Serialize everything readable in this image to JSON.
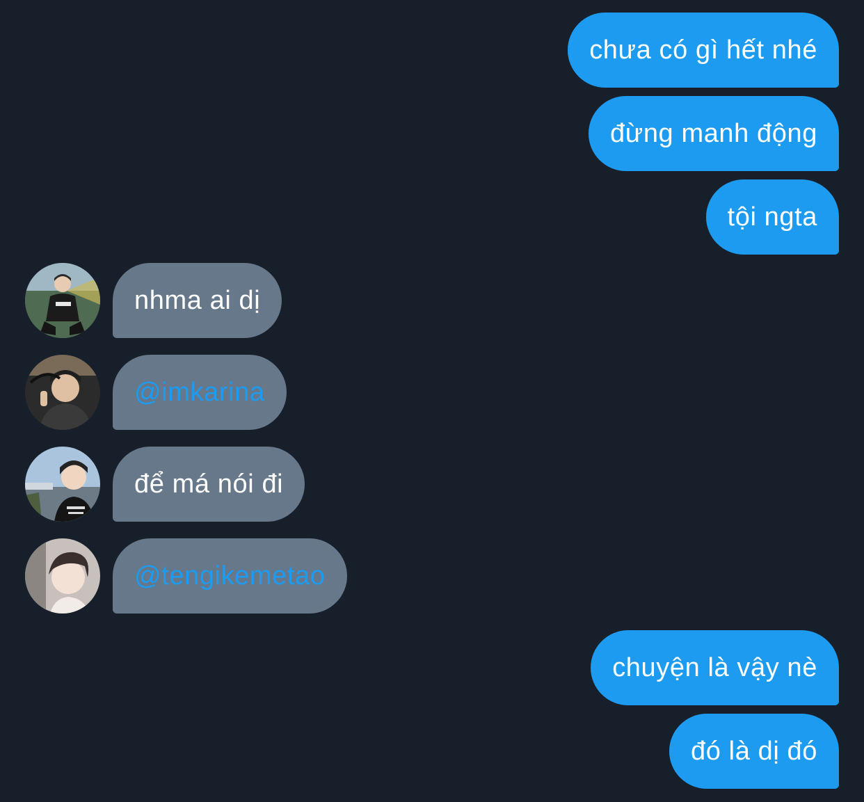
{
  "thread": {
    "messages": [
      {
        "direction": "outgoing",
        "text": "chưa có gì hết nhé"
      },
      {
        "direction": "outgoing",
        "text": "đừng manh động"
      },
      {
        "direction": "outgoing",
        "text": "tội ngta"
      },
      {
        "direction": "incoming",
        "text": "nhma ai dị",
        "avatar": "user-avatar-photo"
      },
      {
        "direction": "incoming",
        "text": "@imkarina",
        "avatar": "user-avatar-photo",
        "is_mention": true
      },
      {
        "direction": "incoming",
        "text": "để má nói đi",
        "avatar": "user-avatar-photo"
      },
      {
        "direction": "incoming",
        "text": "@tengikemetao",
        "avatar": "user-avatar-photo",
        "is_mention": true
      },
      {
        "direction": "outgoing",
        "text": "chuyện là vậy nè"
      },
      {
        "direction": "outgoing",
        "text": "đó là dị đó"
      }
    ]
  },
  "colors": {
    "background": "#17202a",
    "outgoing_bubble": "#1d9bf0",
    "incoming_bubble": "#66788a",
    "mention_text": "#1d9bf0",
    "message_text": "#ffffff"
  }
}
